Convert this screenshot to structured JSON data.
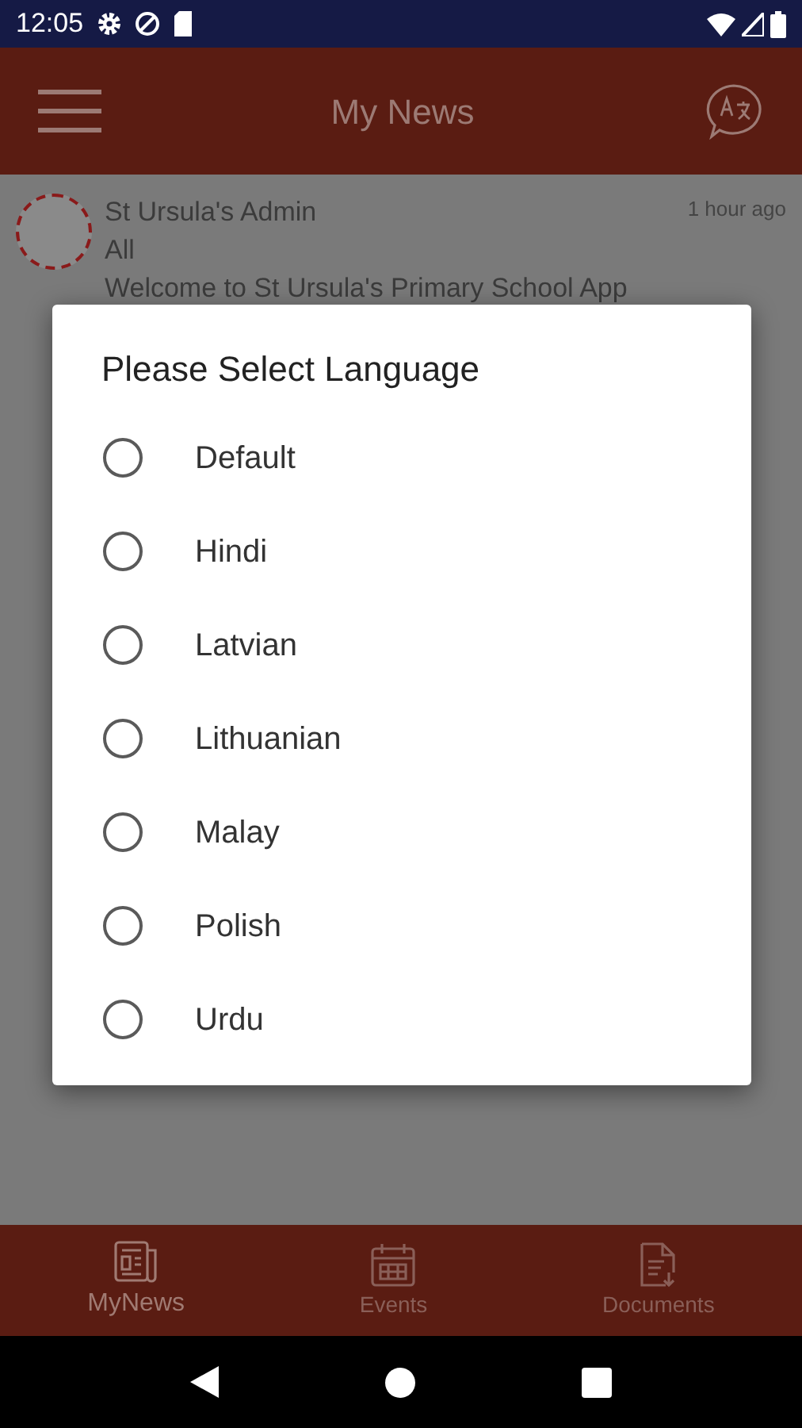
{
  "status_bar": {
    "time": "12:05"
  },
  "app_bar": {
    "title": "My News"
  },
  "news": [
    {
      "author": "St Ursula's Admin",
      "audience": "All",
      "message": "Welcome to St Ursula's Primary School App",
      "time": "1 hour ago"
    }
  ],
  "dialog": {
    "title": "Please Select Language",
    "options": [
      {
        "label": "Default",
        "selected": false
      },
      {
        "label": "Hindi",
        "selected": false
      },
      {
        "label": "Latvian",
        "selected": false
      },
      {
        "label": "Lithuanian",
        "selected": false
      },
      {
        "label": "Malay",
        "selected": false
      },
      {
        "label": "Polish",
        "selected": false
      },
      {
        "label": "Urdu",
        "selected": false
      }
    ]
  },
  "bottom_nav": [
    {
      "kind": "news",
      "label": "MyNews",
      "selected": true
    },
    {
      "kind": "events",
      "label": "Events",
      "selected": false
    },
    {
      "kind": "documents",
      "label": "Documents",
      "selected": false
    }
  ]
}
